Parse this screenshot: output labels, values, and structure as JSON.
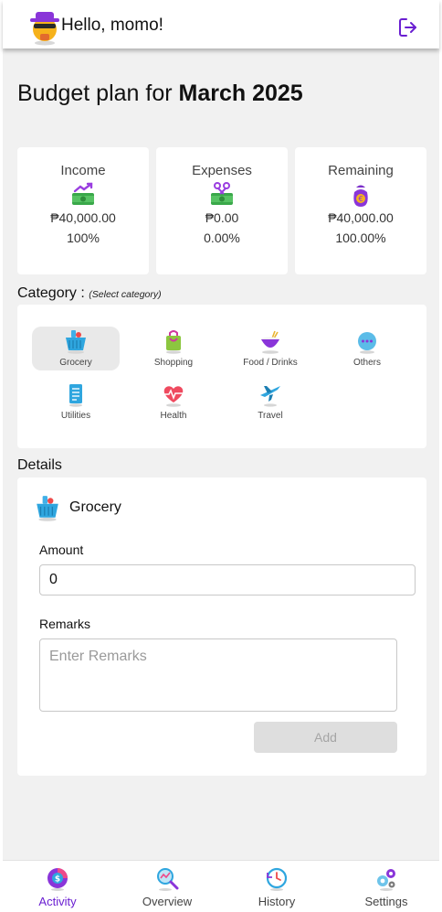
{
  "header": {
    "greeting": "Hello, momo!"
  },
  "title": {
    "prefix": "Budget plan for ",
    "month": "March 2025"
  },
  "summary": [
    {
      "label": "Income",
      "amount": "₱40,000.00",
      "percent": "100%",
      "icon": "money-up-icon"
    },
    {
      "label": "Expenses",
      "amount": "₱0.00",
      "percent": "0.00%",
      "icon": "money-scissors-icon"
    },
    {
      "label": "Remaining",
      "amount": "₱40,000.00",
      "percent": "100.00%",
      "icon": "money-bag-icon"
    }
  ],
  "category": {
    "label": "Category :",
    "hint": "(Select category)",
    "selected": "Grocery",
    "items": [
      {
        "label": "Grocery",
        "icon": "basket-icon"
      },
      {
        "label": "Shopping",
        "icon": "shopping-bag-icon"
      },
      {
        "label": "Food / Drinks",
        "icon": "bowl-icon"
      },
      {
        "label": "Others",
        "icon": "dots-icon"
      },
      {
        "label": "Utilities",
        "icon": "receipt-icon"
      },
      {
        "label": "Health",
        "icon": "heart-icon"
      },
      {
        "label": "Travel",
        "icon": "airplane-icon"
      }
    ]
  },
  "details": {
    "label": "Details",
    "category_name": "Grocery",
    "amount_label": "Amount",
    "amount_value": "0",
    "remarks_label": "Remarks",
    "remarks_placeholder": "Enter Remarks",
    "add_label": "Add"
  },
  "nav": [
    {
      "label": "Activity",
      "icon": "dollar-coin-icon",
      "active": true
    },
    {
      "label": "Overview",
      "icon": "magnifier-chart-icon"
    },
    {
      "label": "History",
      "icon": "clock-history-icon"
    },
    {
      "label": "Settings",
      "icon": "gears-icon"
    }
  ],
  "colors": {
    "accent": "#6a1fd1",
    "background": "#f1f1f1",
    "card": "#ffffff"
  }
}
